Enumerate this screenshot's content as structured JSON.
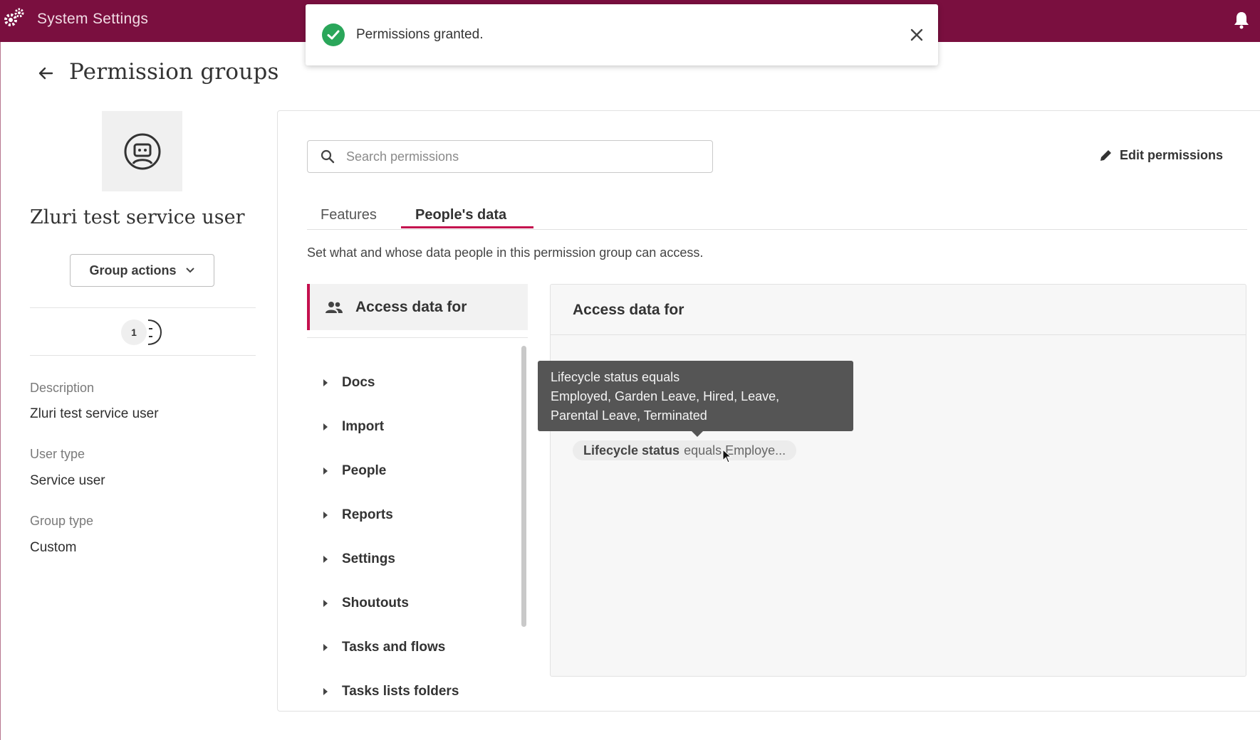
{
  "app": {
    "title": "System Settings"
  },
  "toast": {
    "message": "Permissions granted."
  },
  "page": {
    "title": "Permission groups"
  },
  "group": {
    "name": "Zluri test service user",
    "actions_label": "Group actions",
    "member_count": "1",
    "description_label": "Description",
    "description_value": "Zluri test service user",
    "user_type_label": "User type",
    "user_type_value": "Service user",
    "group_type_label": "Group type",
    "group_type_value": "Custom"
  },
  "search": {
    "placeholder": "Search permissions"
  },
  "edit_permissions_label": "Edit permissions",
  "tabs": [
    {
      "label": "Features",
      "active": false
    },
    {
      "label": "People's data",
      "active": true
    }
  ],
  "hint": "Set what and whose data people in this permission group can access.",
  "nav": {
    "header": "Access data for",
    "items": [
      "Docs",
      "Import",
      "People",
      "Reports",
      "Settings",
      "Shoutouts",
      "Tasks and flows",
      "Tasks lists folders"
    ]
  },
  "panel": {
    "title": "Access data for",
    "chip_field": "Lifecycle status",
    "chip_rest": "equals Employe..."
  },
  "tooltip": {
    "line1": "Lifecycle status equals",
    "line2": "Employed, Garden Leave, Hired, Leave,",
    "line3": "Parental Leave, Terminated"
  },
  "colors": {
    "brand": "#7a0f3f",
    "accent": "#c4104e",
    "success": "#2aa65a"
  }
}
